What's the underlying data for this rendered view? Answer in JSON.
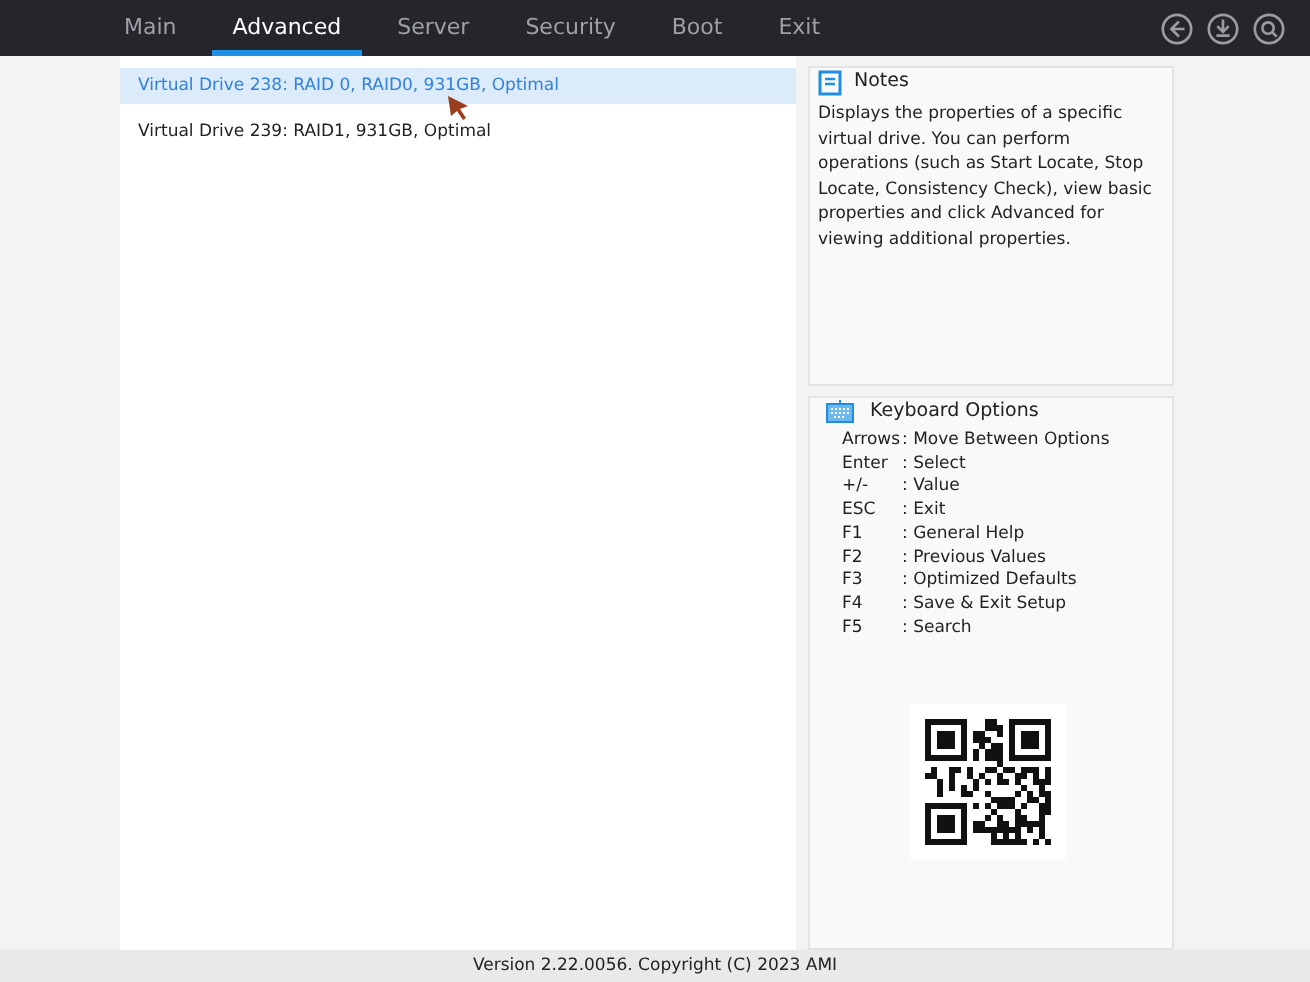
{
  "tabs": [
    {
      "label": "Main",
      "selected": false
    },
    {
      "label": "Advanced",
      "selected": true
    },
    {
      "label": "Server",
      "selected": false
    },
    {
      "label": "Security",
      "selected": false
    },
    {
      "label": "Boot",
      "selected": false
    },
    {
      "label": "Exit",
      "selected": false
    }
  ],
  "items": [
    {
      "label": "Virtual Drive 238: RAID 0, RAID0, 931GB, Optimal",
      "selected": true
    },
    {
      "label": "Virtual Drive 239: RAID1, 931GB, Optimal",
      "selected": false
    }
  ],
  "notes": {
    "title": "Notes",
    "text": "Displays the properties of a specific virtual drive. You can perform operations (such as Start Locate, Stop Locate, Consistency Check), view basic properties and click Advanced for viewing additional properties."
  },
  "keyboard_options": {
    "title": "Keyboard Options",
    "keys": [
      {
        "key": "Arrows",
        "action": ": Move Between Options"
      },
      {
        "key": "Enter",
        "action": ": Select"
      },
      {
        "key": "+/-",
        "action": ": Value"
      },
      {
        "key": "ESC",
        "action": ": Exit"
      },
      {
        "key": "F1",
        "action": ": General Help"
      },
      {
        "key": "F2",
        "action": ": Previous Values"
      },
      {
        "key": "F3",
        "action": ": Optimized Defaults"
      },
      {
        "key": "F4",
        "action": ": Save & Exit Setup"
      },
      {
        "key": "F5",
        "action": ": Search"
      }
    ]
  },
  "status_bar": "Version 2.22.0056. Copyright (C) 2023 AMI"
}
